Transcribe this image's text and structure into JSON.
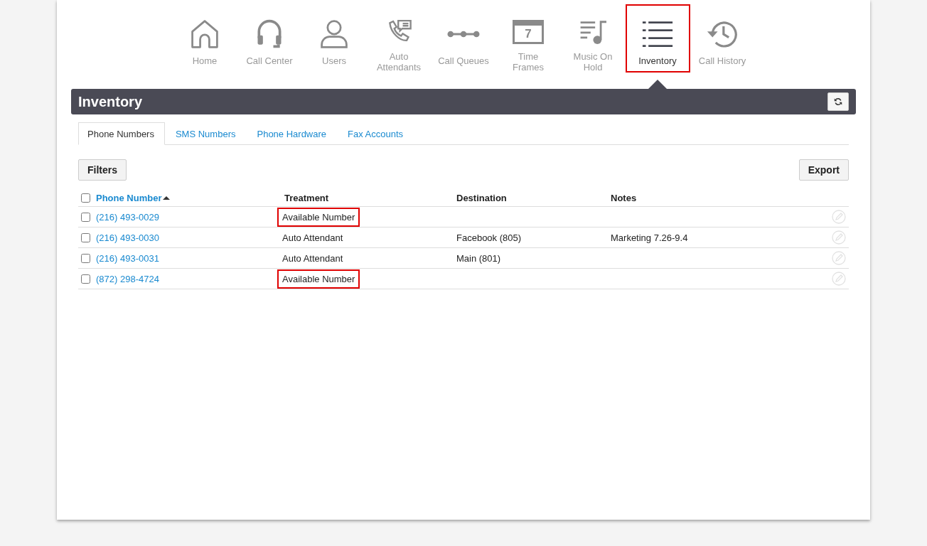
{
  "nav": [
    {
      "kind": "home",
      "label": "Home",
      "selected": false,
      "highlighted": false
    },
    {
      "kind": "headset",
      "label": "Call Center",
      "selected": false,
      "highlighted": false
    },
    {
      "kind": "user",
      "label": "Users",
      "selected": false,
      "highlighted": false
    },
    {
      "kind": "phone",
      "label": "Auto Attendants",
      "selected": false,
      "highlighted": false
    },
    {
      "kind": "queue",
      "label": "Call Queues",
      "selected": false,
      "highlighted": false
    },
    {
      "kind": "calendar",
      "label": "Time Frames",
      "calendar_day": "7",
      "selected": false,
      "highlighted": false
    },
    {
      "kind": "music",
      "label": "Music On Hold",
      "selected": false,
      "highlighted": false
    },
    {
      "kind": "list",
      "label": "Inventory",
      "selected": true,
      "highlighted": true
    },
    {
      "kind": "history",
      "label": "Call History",
      "selected": false,
      "highlighted": false
    }
  ],
  "panel": {
    "title": "Inventory"
  },
  "tabs": [
    {
      "label": "Phone Numbers",
      "selected": true
    },
    {
      "label": "SMS Numbers",
      "selected": false
    },
    {
      "label": "Phone Hardware",
      "selected": false
    },
    {
      "label": "Fax Accounts",
      "selected": false
    }
  ],
  "buttons": {
    "filters": "Filters",
    "export": "Export"
  },
  "table": {
    "select_all_checked": false,
    "columns": [
      {
        "label": "Phone Number",
        "sortable": true,
        "sorted": true
      },
      {
        "label": "Treatment",
        "sortable": false,
        "sorted": false
      },
      {
        "label": "Destination",
        "sortable": false,
        "sorted": false
      },
      {
        "label": "Notes",
        "sortable": false,
        "sorted": false
      }
    ],
    "rows": [
      {
        "checked": false,
        "phone": "(216) 493-0029",
        "treatment": "Available Number",
        "treatment_highlighted": true,
        "destination": "",
        "notes": ""
      },
      {
        "checked": false,
        "phone": "(216) 493-0030",
        "treatment": "Auto Attendant",
        "treatment_highlighted": false,
        "destination": "Facebook (805)",
        "notes": "Marketing 7.26-9.4"
      },
      {
        "checked": false,
        "phone": "(216) 493-0031",
        "treatment": "Auto Attendant",
        "treatment_highlighted": false,
        "destination": "Main (801)",
        "notes": ""
      },
      {
        "checked": false,
        "phone": "(872) 298-4724",
        "treatment": "Available Number",
        "treatment_highlighted": true,
        "destination": "",
        "notes": ""
      }
    ]
  }
}
